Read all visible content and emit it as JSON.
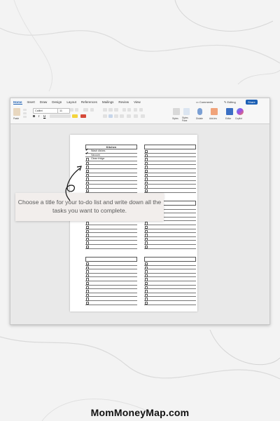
{
  "menubar": {
    "tabs": [
      "Home",
      "Insert",
      "Draw",
      "Design",
      "Layout",
      "References",
      "Mailings",
      "Review",
      "View"
    ],
    "active_tab": "Home",
    "comments_label": "Comments",
    "editing_label": "Editing",
    "share_label": "Share"
  },
  "ribbon": {
    "paste_label": "Paste",
    "font_name": "Calibri",
    "font_size": "11",
    "styles_label": "Styles",
    "styles_pane_label": "Styles Pane",
    "dictate_label": "Dictate",
    "addins_label": "Add-ins",
    "editor_label": "Editor",
    "copilot_label": "Copilot"
  },
  "document": {
    "lists": [
      {
        "title": "Kitchen",
        "items": [
          {
            "text": "Wash dishes",
            "checked": true
          },
          {
            "text": "Vacuum",
            "checked": true
          },
          {
            "text": "Clean fridge",
            "checked": false
          },
          {
            "text": "",
            "checked": false
          },
          {
            "text": "",
            "checked": false
          },
          {
            "text": "",
            "checked": false
          },
          {
            "text": "",
            "checked": false
          },
          {
            "text": "",
            "checked": false
          },
          {
            "text": "",
            "checked": false
          },
          {
            "text": "",
            "checked": false
          },
          {
            "text": "",
            "checked": false
          }
        ]
      },
      {
        "title": "",
        "items": 11
      },
      {
        "title": "",
        "items": 11
      },
      {
        "title": "",
        "items": 11
      },
      {
        "title": "",
        "items": 11
      },
      {
        "title": "",
        "items": 11
      }
    ]
  },
  "callout": {
    "text": "Choose a title for your to-do list and write down all the tasks you want to complete."
  },
  "brand": {
    "text": "MomMoneyMap.com"
  },
  "colors": {
    "accent": "#1b5fb4",
    "callout_bg": "#f2eeec",
    "marble_vein": "#d9d9d9"
  }
}
